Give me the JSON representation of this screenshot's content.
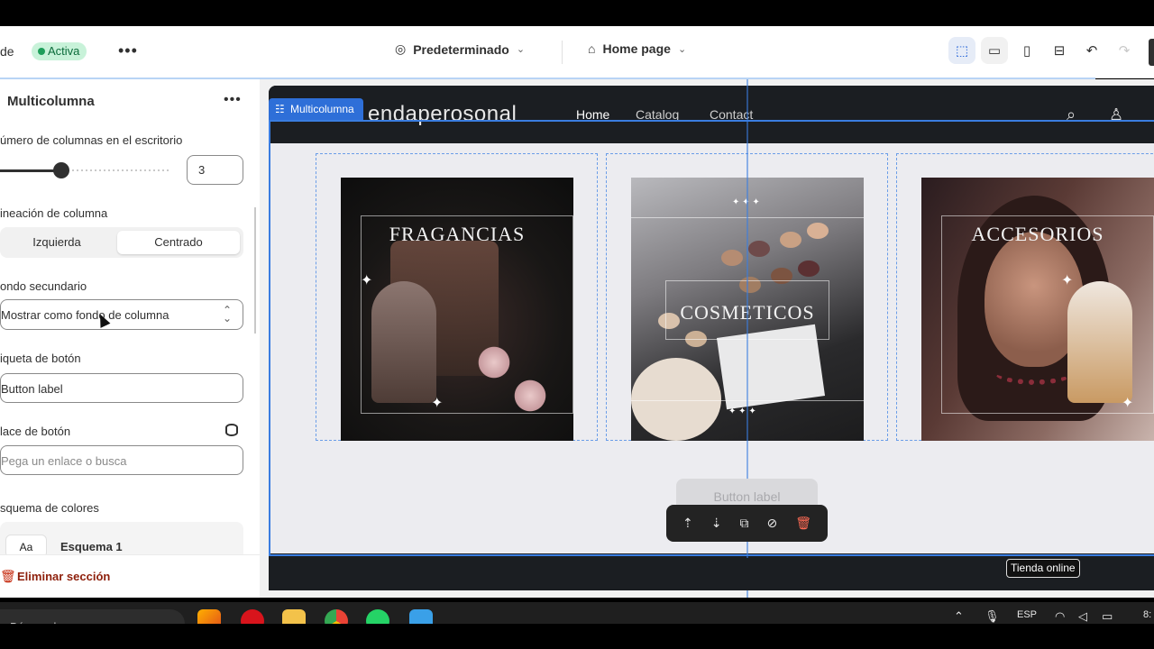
{
  "header": {
    "theme_fragment": "de",
    "status_badge": "Activa",
    "more": "•••",
    "template_select": "Predeterminado",
    "page_select": "Home page"
  },
  "panel": {
    "title": "Multicolumna",
    "more": "•••",
    "columns_label": "úmero de columnas en el escritorio",
    "columns_value": "3",
    "columns_slider_fraction": 0.35,
    "alignment_label": "ineación de columna",
    "alignment_options": [
      "Izquierda",
      "Centrado"
    ],
    "alignment_selected": "Centrado",
    "secondary_bg_label": "ondo secundario",
    "secondary_bg_value": "Mostrar como fondo de columna",
    "button_label_label": "iqueta de botón",
    "button_label_value": "Button label",
    "button_link_label": "lace de botón",
    "button_link_placeholder": "Pega un enlace o busca",
    "color_scheme_label": "squema de colores",
    "scheme_preview": "Aa",
    "scheme_name": "Esquema 1",
    "delete_section": "Eliminar sección"
  },
  "preview": {
    "section_tag": "Multicolumna",
    "logo": "endaperosonal",
    "nav": [
      "Home",
      "Catalog",
      "Contact"
    ],
    "columns": [
      {
        "title": "FRAGANCIAS"
      },
      {
        "title": "COSMETICOS"
      },
      {
        "title": "ACCESORIOS"
      }
    ],
    "button_ghost": "Button label",
    "tooltip": "Tienda online"
  },
  "taskbar": {
    "search": "Búsqueda",
    "lang": "ESP",
    "clock_fragment": "8:"
  },
  "colors": {
    "accent_blue": "#2e6fd8",
    "badge_green": "#c8f2d9",
    "danger": "#c5280c"
  }
}
